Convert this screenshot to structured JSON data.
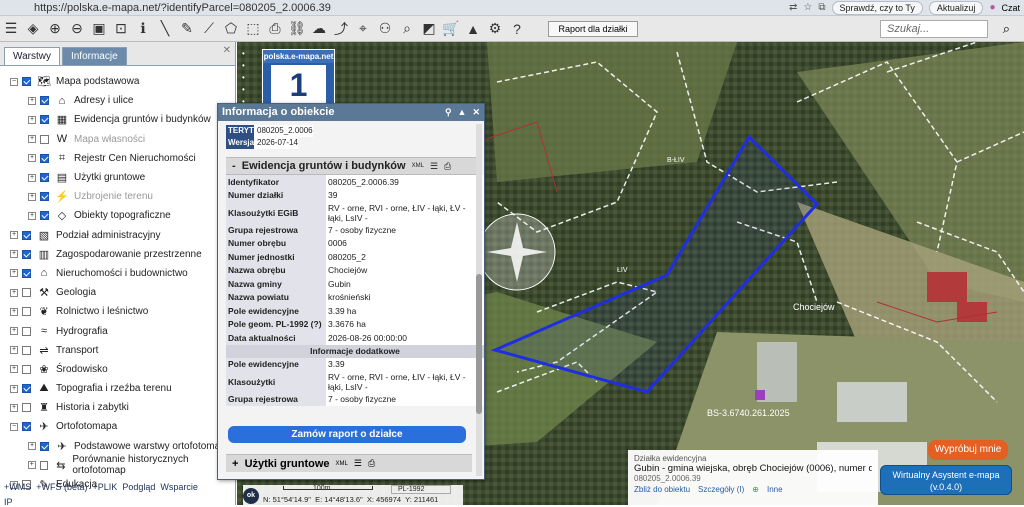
{
  "browser": {
    "url": "https://polska.e-mapa.net/?identifyParcel=080205_2.0006.39",
    "btn1": "Sprawdź, czy to Ty",
    "btn2": "Aktualizuj",
    "btn3": "Czat"
  },
  "toolbar": {
    "raport": "Raport dla działki",
    "search_placeholder": "Szukaj..."
  },
  "left": {
    "tab1": "Warstwy",
    "tab2": "Informacje",
    "items": [
      {
        "label": "Mapa podstawowa",
        "level": 0,
        "checked": true,
        "icon": "map-base-icon"
      },
      {
        "label": "Adresy i ulice",
        "level": 1,
        "checked": true,
        "icon": "address-icon"
      },
      {
        "label": "Ewidencja gruntów i budynków",
        "level": 1,
        "checked": true,
        "icon": "cadastre-icon"
      },
      {
        "label": "Mapa własności",
        "level": 1,
        "checked": false,
        "icon": "ownership-icon",
        "grey": true
      },
      {
        "label": "Rejestr Cen Nieruchomości",
        "level": 1,
        "checked": true,
        "icon": "price-register-icon"
      },
      {
        "label": "Użytki gruntowe",
        "level": 1,
        "checked": true,
        "icon": "land-use-icon"
      },
      {
        "label": "Uzbrojenie terenu",
        "level": 1,
        "checked": true,
        "icon": "utilities-icon",
        "grey": true
      },
      {
        "label": "Obiekty topograficzne",
        "level": 1,
        "checked": true,
        "icon": "topo-objects-icon"
      },
      {
        "label": "Podział administracyjny",
        "level": 0,
        "checked": true,
        "icon": "admin-division-icon"
      },
      {
        "label": "Zagospodarowanie przestrzenne",
        "level": 0,
        "checked": true,
        "icon": "planning-icon"
      },
      {
        "label": "Nieruchomości i budownictwo",
        "level": 0,
        "checked": true,
        "icon": "buildings-icon"
      },
      {
        "label": "Geologia",
        "level": 0,
        "checked": false,
        "icon": "geology-icon"
      },
      {
        "label": "Rolnictwo i leśnictwo",
        "level": 0,
        "checked": false,
        "icon": "agriculture-icon"
      },
      {
        "label": "Hydrografia",
        "level": 0,
        "checked": false,
        "icon": "hydrography-icon"
      },
      {
        "label": "Transport",
        "level": 0,
        "checked": false,
        "icon": "transport-icon"
      },
      {
        "label": "Środowisko",
        "level": 0,
        "checked": false,
        "icon": "environment-icon"
      },
      {
        "label": "Topografia i rzeźba terenu",
        "level": 0,
        "checked": true,
        "icon": "topography-icon"
      },
      {
        "label": "Historia i zabytki",
        "level": 0,
        "checked": false,
        "icon": "history-icon"
      },
      {
        "label": "Ortofotomapa",
        "level": 0,
        "checked": true,
        "icon": "orthophoto-icon"
      },
      {
        "label": "Podstawowe warstwy ortofotomapy",
        "level": 1,
        "checked": true,
        "icon": "orthophoto-layers-icon"
      },
      {
        "label": "Porównanie historycznych ortofotomap",
        "level": 1,
        "checked": false,
        "icon": "orthophoto-compare-icon"
      },
      {
        "label": "Edukacja",
        "level": 0,
        "checked": false,
        "icon": "education-icon"
      }
    ],
    "links": [
      "+WMS",
      "+WFS (beta)",
      "+PLIK",
      "Podgląd",
      "Wsparcie"
    ],
    "ip": "IP"
  },
  "popup": {
    "title": "Informacja o obiekcie",
    "teryt": [
      {
        "k": "TERYT",
        "v": "080205_2.0006"
      },
      {
        "k": "Wersja",
        "v": "2026-07-14"
      }
    ],
    "section1": "Ewidencja gruntów i budynków",
    "xml": "XML",
    "rows": [
      {
        "k": "Identyfikator",
        "v": "080205_2.0006.39"
      },
      {
        "k": "Numer działki",
        "v": "39"
      },
      {
        "k": "Klasoużytki EGiB",
        "v": "RV - orne, RVI - orne, ŁIV - łąki, ŁV - łąki, LsIV -"
      },
      {
        "k": "Grupa rejestrowa",
        "v": "7 - osoby fizyczne"
      },
      {
        "k": "Numer obrębu",
        "v": "0006"
      },
      {
        "k": "Numer jednostki",
        "v": "080205_2"
      },
      {
        "k": "Nazwa obrębu",
        "v": "Chociejów"
      },
      {
        "k": "Nazwa gminy",
        "v": "Gubin"
      },
      {
        "k": "Nazwa powiatu",
        "v": "krośnieński"
      },
      {
        "k": "Pole ewidencyjne",
        "v": "3.39 ha"
      },
      {
        "k": "Pole geom. PL-1992 (?)",
        "v": "3.3676 ha"
      },
      {
        "k": "Data aktualności",
        "v": "2026-08-26 00:00:00"
      }
    ],
    "extra_header": "Informacje dodatkowe",
    "extra_rows": [
      {
        "k": "Pole ewidencyjne",
        "v": "3.39"
      },
      {
        "k": "Klasoużytki",
        "v": "RV - orne, RVI - orne, ŁIV - łąki, ŁV - łąki, LsIV -"
      },
      {
        "k": "Grupa rejestrowa",
        "v": "7 - osoby fizyczne"
      }
    ],
    "order_btn": "Zamów raport o działce",
    "section2": "Użytki gruntowe"
  },
  "badge": {
    "site": "polska.e-mapa.net",
    "number": "1"
  },
  "parcel": {
    "l1": "Działka ewidencyjna",
    "l2": "Gubin - gmina wiejska, obręb Chociejów (0006), numer dz 39",
    "l3": "080205_2.0006.39",
    "links": [
      "Zbliż do obiektu",
      "Szczegóły (I)",
      "Inne"
    ]
  },
  "map_labels": {
    "l1": "BS-3.6740.261.2025",
    "l2": "Chociejów",
    "l3": "ŁIV",
    "l4": "B-ŁIV"
  },
  "buttons": {
    "try": "Wypróbuj mnie",
    "assistant1": "Wirtualny Asystent e-mapa",
    "assistant2": "(v.0.4.0)"
  },
  "coords": {
    "scale": "100m",
    "crs": "PL-1992",
    "ok": "ok",
    "n": "N: 51°54'14.9\"",
    "e": "E: 14°48'13.6\"",
    "x": "X: 456974",
    "y": "Y: 211461"
  },
  "colors": {
    "accent": "#2a6fdc",
    "parcel": "#1f2fe0"
  }
}
